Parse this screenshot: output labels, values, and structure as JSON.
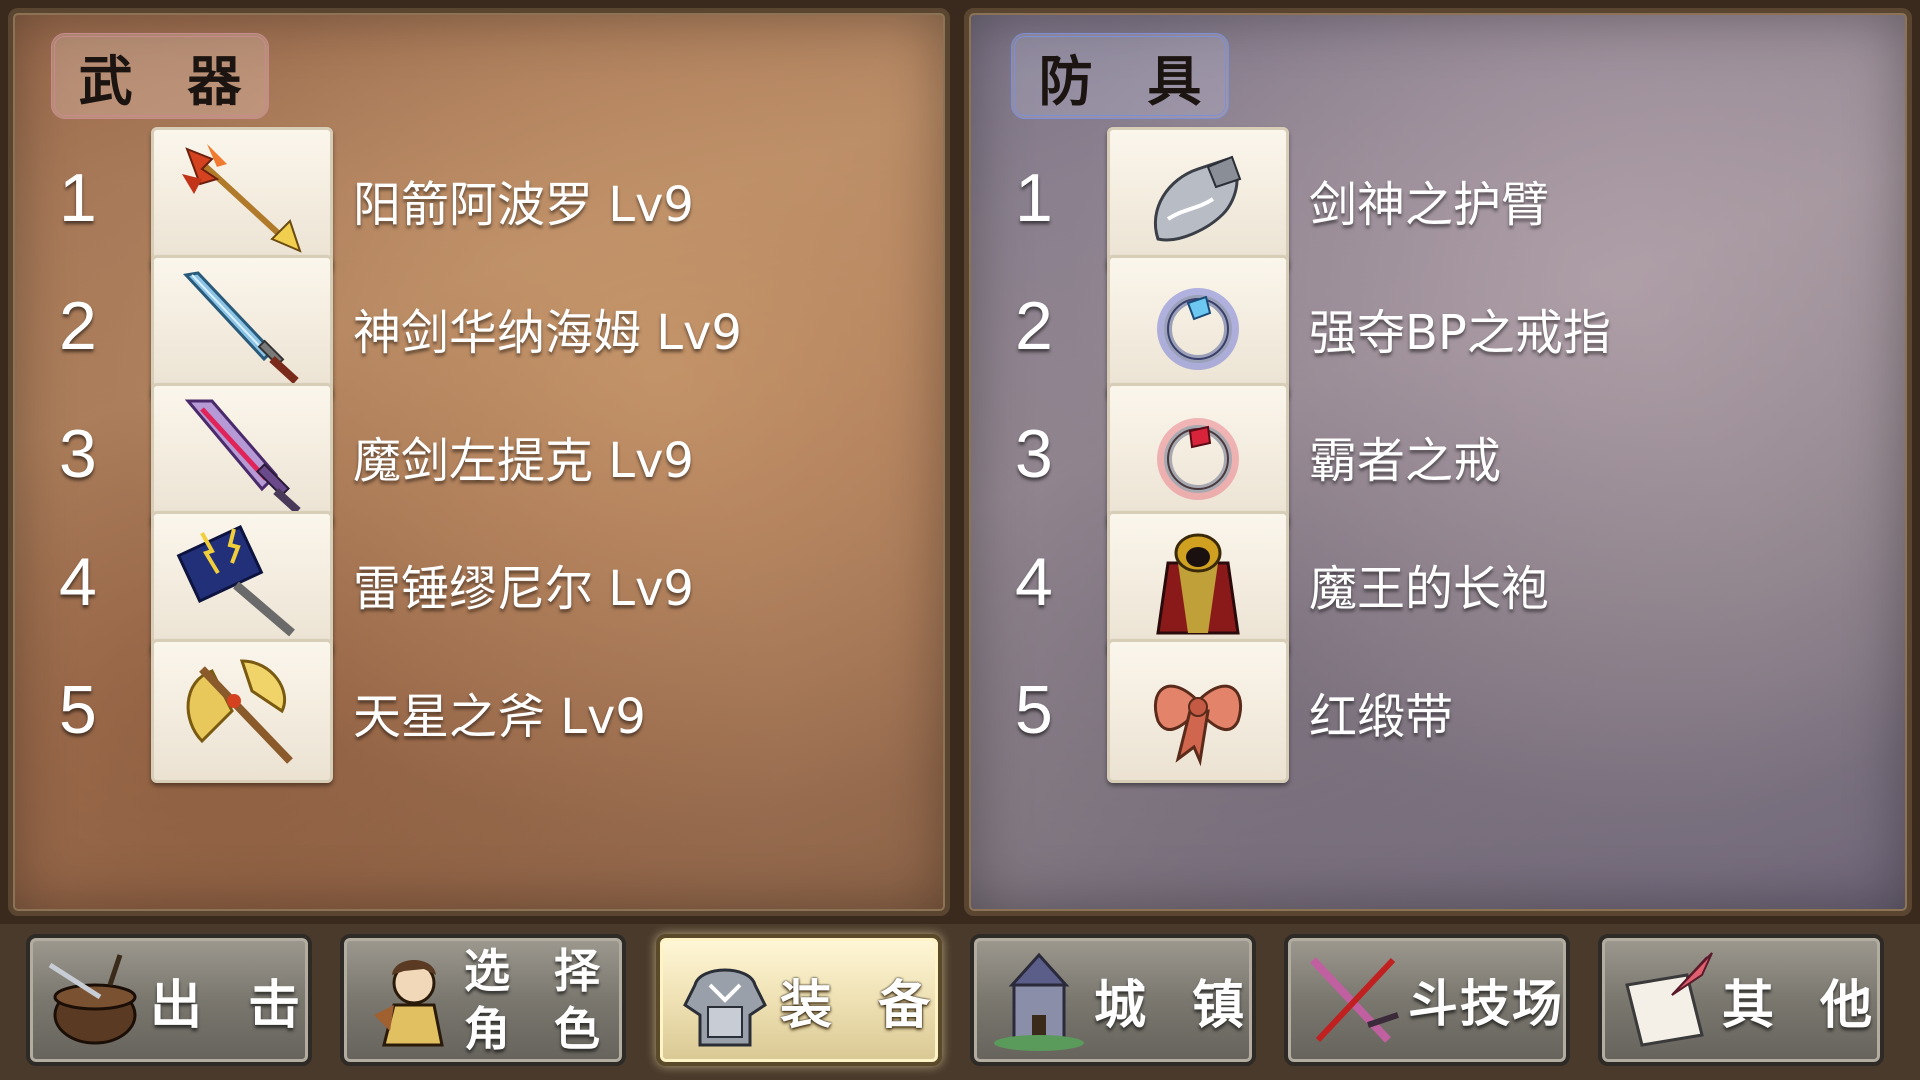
{
  "weapons": {
    "title": "武 器",
    "items": [
      {
        "num": "1",
        "name": "阳箭阿波罗 Lv9",
        "icon": "golden-arrow-icon"
      },
      {
        "num": "2",
        "name": "神剑华纳海姆 Lv9",
        "icon": "blue-sword-icon"
      },
      {
        "num": "3",
        "name": "魔剑左提克 Lv9",
        "icon": "purple-demon-sword-icon"
      },
      {
        "num": "4",
        "name": "雷锤缪尼尔 Lv9",
        "icon": "thunder-hammer-icon"
      },
      {
        "num": "5",
        "name": "天星之斧 Lv9",
        "icon": "golden-axe-icon"
      }
    ]
  },
  "armor": {
    "title": "防 具",
    "items": [
      {
        "num": "1",
        "name": "剑神之护臂",
        "icon": "gauntlet-icon"
      },
      {
        "num": "2",
        "name": "强夺BP之戒指",
        "icon": "blue-ring-icon"
      },
      {
        "num": "3",
        "name": "霸者之戒",
        "icon": "red-ring-icon"
      },
      {
        "num": "4",
        "name": "魔王的长袍",
        "icon": "demon-robe-icon"
      },
      {
        "num": "5",
        "name": "红缎带",
        "icon": "red-ribbon-icon"
      }
    ]
  },
  "nav": {
    "sortie": "出 击",
    "select_line1": "选 择",
    "select_line2": "角 色",
    "equipment": "装 备",
    "town": "城 镇",
    "arena": "斗技场",
    "other": "其 他",
    "active": "equipment"
  },
  "colors": {
    "weapon_panel": "#a9795a",
    "armor_panel": "#8a8087",
    "weapon_tag_border": "#c98a8f",
    "armor_tag_border": "#7c8fd8",
    "active_nav": "#efe1b4"
  }
}
